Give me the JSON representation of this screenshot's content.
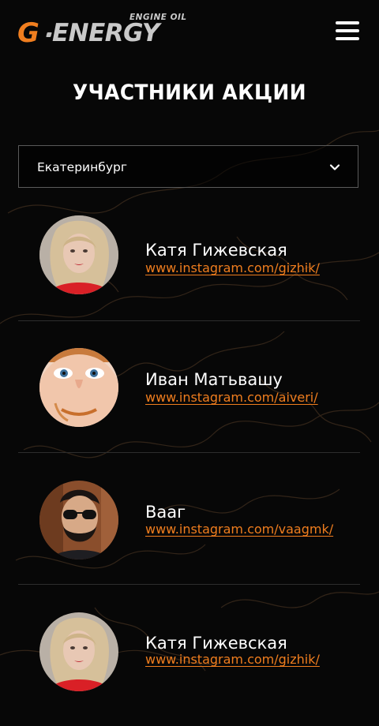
{
  "brand": {
    "logo_g": "G",
    "logo_word": "ENERGY",
    "logo_sub": "ENGINE OIL",
    "logo_color": "#f07e1f"
  },
  "header": {
    "menu_icon": "hamburger-menu-icon"
  },
  "page": {
    "title": "УЧАСТНИКИ АКЦИИ"
  },
  "city_select": {
    "value": "Екатеринбург",
    "icon": "chevron-down-icon"
  },
  "participants": [
    {
      "name": "Катя Гижевская",
      "link": "www.instagram.com/gizhik/"
    },
    {
      "name": "Иван Матьвашу",
      "link": "www.instagram.com/aiveri/"
    },
    {
      "name": "Вааг",
      "link": "www.instagram.com/vaagmk/"
    },
    {
      "name": "Катя Гижевская",
      "link": "www.instagram.com/gizhik/"
    }
  ],
  "colors": {
    "accent": "#ef7d1e",
    "background": "#070707",
    "divider": "#2d2d2d"
  }
}
